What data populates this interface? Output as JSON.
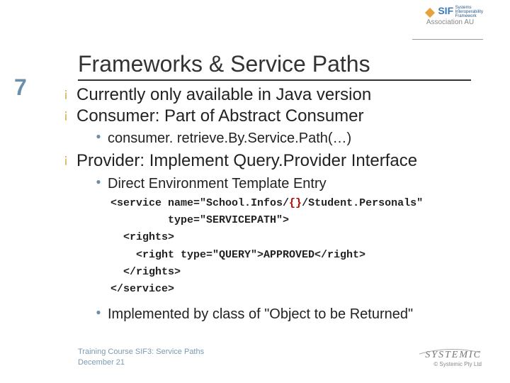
{
  "logo": {
    "sif_text": "SIF",
    "tagline1": "Systems",
    "tagline2": "Interoperability",
    "tagline3": "Framework",
    "assoc": "Association AU"
  },
  "page_number": "7",
  "title": "Frameworks & Service Paths",
  "bullets": {
    "b1a": "Currently only available in Java version",
    "b1b": "Consumer: Part of Abstract Consumer",
    "b2a": "consumer. retrieve.By.Service.Path(…)",
    "b1c": "Provider: Implement Query.Provider Interface",
    "b2b": "Direct Environment Template Entry",
    "b2c": "Implemented by class of \"Object to be Returned\""
  },
  "code": {
    "l1a": "<service name=\"School.Infos/",
    "l1b": "{}",
    "l1c": "/Student.Personals\"",
    "l2": "         type=\"SERVICEPATH\">",
    "l3": "  <rights>",
    "l4": "    <right type=\"QUERY\">APPROVED</right>",
    "l5": "  </rights>",
    "l6": "</service>"
  },
  "footer": {
    "line1": "Training Course SIF3: Service Paths",
    "line2": "December 21",
    "brand": "SYSTEMIC",
    "copyright": "© Systemic Pty Ltd"
  }
}
